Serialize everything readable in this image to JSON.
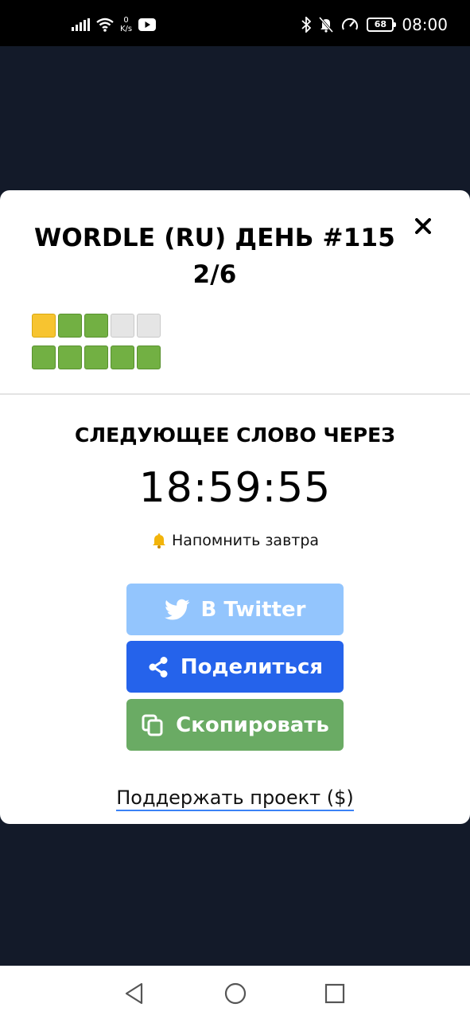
{
  "status_bar": {
    "speed_value": "0",
    "speed_unit": "K/s",
    "battery": "68",
    "time": "08:00",
    "icons": [
      "signal-icon",
      "wifi-icon",
      "youtube-icon",
      "bluetooth-icon",
      "mute-icon",
      "speed-icon",
      "battery-icon"
    ]
  },
  "modal": {
    "title_line1": "WORDLE (RU) ДЕНЬ #115",
    "title_line2": "2/6",
    "close_icon": "close-icon",
    "guesses": [
      [
        "present",
        "correct",
        "correct",
        "absent",
        "absent"
      ],
      [
        "correct",
        "correct",
        "correct",
        "correct",
        "correct"
      ]
    ],
    "next_word_label": "СЛЕДУЮЩЕЕ СЛОВО ЧЕРЕЗ",
    "countdown": "18:59:55",
    "remind_label": "Напомнить завтра",
    "buttons": {
      "twitter": "В Twitter",
      "share": "Поделиться",
      "copy": "Скопировать"
    },
    "support_link": "Поддержать проект ($)"
  },
  "colors": {
    "present": "#f7c430",
    "correct": "#72b043",
    "absent": "#e5e5e5",
    "twitter_button": "#93c5fd",
    "share_button": "#2563eb",
    "copy_button": "#6aab64",
    "backdrop": "#131a29"
  }
}
